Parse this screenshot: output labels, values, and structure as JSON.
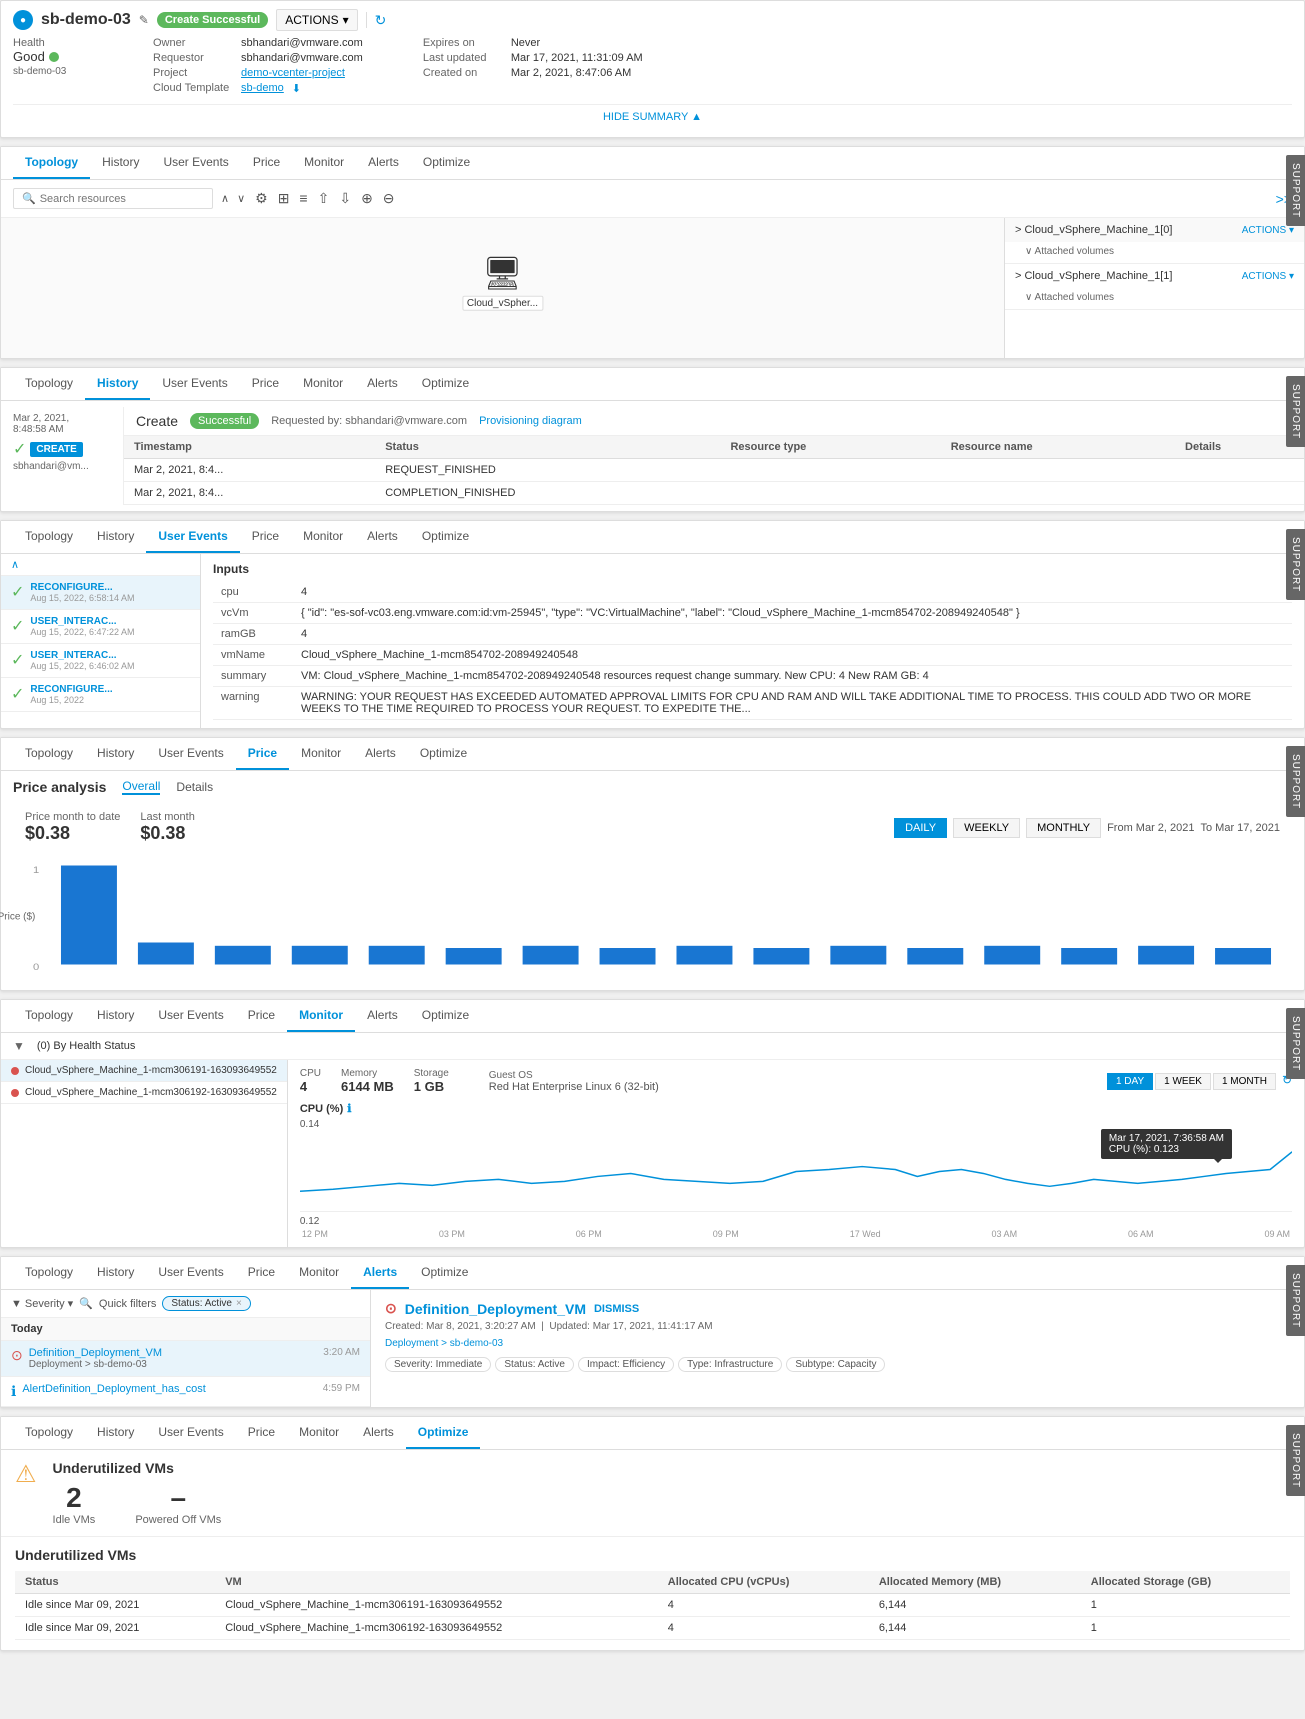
{
  "header": {
    "logo": "sb",
    "title": "sb-demo-03",
    "status": "Create Successful",
    "actions_label": "ACTIONS",
    "health_label": "Health",
    "health_value": "Good",
    "row1": {
      "owner_label": "Owner",
      "owner_val": "sbhandari@vmware.com",
      "expires_label": "Expires on",
      "expires_val": "Never"
    },
    "row2": {
      "requestor_label": "Requestor",
      "requestor_val": "sbhandari@vmware.com",
      "last_updated_label": "Last updated",
      "last_updated_val": "Mar 17, 2021, 11:31:09 AM"
    },
    "row3": {
      "project_label": "Project",
      "project_val": "demo-vcenter-project",
      "created_label": "Created on",
      "created_val": "Mar 2, 2021, 8:47:06 AM"
    },
    "row4": {
      "cloud_template_label": "Cloud Template",
      "cloud_template_val": "sb-demo"
    },
    "hide_summary": "HIDE SUMMARY ▲"
  },
  "tabs": {
    "topology": "Topology",
    "history": "History",
    "user_events": "User Events",
    "price": "Price",
    "monitor": "Monitor",
    "alerts": "Alerts",
    "optimize": "Optimize"
  },
  "topology_panel": {
    "search_placeholder": "Search resources",
    "vm_label": "Cloud_vSpher...",
    "resource1_name": "> Cloud_vSphere_Machine_1[0]",
    "resource1_actions": "ACTIONS ▾",
    "attached1": "∨ Attached volumes",
    "resource2_name": "> Cloud_vSphere_Machine_1[1]",
    "resource2_actions": "ACTIONS ▾",
    "attached2": "∨ Attached volumes"
  },
  "history_panel": {
    "event_date": "Mar 2, 2021,",
    "event_time": "8:48:58 AM",
    "event_user": "sbhandari@vm...",
    "badge": "CREATE",
    "create_label": "Create",
    "success_badge": "Successful",
    "requested_by": "Requested by: sbhandari@vmware.com",
    "prov_link": "Provisioning diagram",
    "table": {
      "cols": [
        "Timestamp",
        "Status",
        "Resource type",
        "Resource name",
        "Details"
      ],
      "rows": [
        [
          "Mar 2, 2021, 8:4...",
          "REQUEST_FINISHED",
          "",
          "",
          ""
        ],
        [
          "Mar 2, 2021, 8:4...",
          "COMPLETION_FINISHED",
          "",
          "",
          ""
        ]
      ]
    }
  },
  "user_events_panel": {
    "events": [
      {
        "date": "Aug 15, 2022, 6:58:14 AM",
        "name": "RECONFIGURE...",
        "selected": true
      },
      {
        "date": "Aug 15, 2022, 6:47:22 AM",
        "name": "USER_INTERAC..."
      },
      {
        "date": "Aug 15, 2022, 6:46:02 AM",
        "name": "USER_INTERAC..."
      },
      {
        "date": "Aug 15, 2022",
        "name": "RECONFIGURE..."
      }
    ],
    "inputs_title": "Inputs",
    "inputs": [
      {
        "key": "cpu",
        "value": "4"
      },
      {
        "key": "vcVm",
        "value": "{ \"id\": \"es-sof-vc03.eng.vmware.com:id:vm-25945\", \"type\": \"VC:VirtualMachine\", \"label\": \"Cloud_vSphere_Machine_1-mcm854702-208949240548\" }"
      },
      {
        "key": "ramGB",
        "value": "4"
      },
      {
        "key": "vmName",
        "value": "Cloud_vSphere_Machine_1-mcm854702-208949240548"
      },
      {
        "key": "summary",
        "value": "VM: Cloud_vSphere_Machine_1-mcm854702-208949240548 resources request change summary. New CPU: 4 New RAM GB: 4"
      },
      {
        "key": "warning",
        "value": "WARNING: YOUR REQUEST HAS EXCEEDED AUTOMATED APPROVAL LIMITS FOR CPU AND RAM AND WILL TAKE ADDITIONAL TIME TO PROCESS. THIS COULD ADD TWO OR MORE WEEKS TO THE TIME REQUIRED TO PROCESS YOUR REQUEST. TO EXPEDITE THE..."
      }
    ]
  },
  "price_panel": {
    "price_analysis": "Price analysis",
    "tab_overall": "Overall",
    "tab_details": "Details",
    "month_to_date_label": "Price month to date",
    "month_to_date_val": "$0.38",
    "last_month_label": "Last month",
    "last_month_val": "$0.38",
    "daily": "DAILY",
    "weekly": "WEEKLY",
    "monthly": "MONTHLY",
    "from": "From Mar 2, 2021",
    "to": "To Mar 17, 2021",
    "y_axis_label": "Price ($)",
    "chart_values": [
      0.9,
      0.15,
      0.15,
      0.15,
      0.15,
      0.12,
      0.15,
      0.12,
      0.15,
      0.12,
      0.15,
      0.12,
      0.15,
      0.12,
      0.15,
      0.12
    ]
  },
  "monitor_panel": {
    "filter_label": "(0) By Health Status",
    "vms": [
      {
        "name": "Cloud_vSphere_Machine_1-mcm306191-163093649552",
        "selected": true
      },
      {
        "name": "Cloud_vSphere_Machine_1-mcm306192-163093649552"
      }
    ],
    "cpu_label": "CPU",
    "cpu_val": "4",
    "memory_label": "Memory",
    "memory_val": "6144 MB",
    "storage_label": "Storage",
    "storage_val": "1 GB",
    "guest_os_label": "Guest OS",
    "guest_os_val": "Red Hat Enterprise Linux 6 (32-bit)",
    "day_btn": "1 DAY",
    "week_btn": "1 WEEK",
    "month_btn": "1 MONTH",
    "cpu_chart_title": "CPU (%)",
    "tooltip_date": "Mar 17, 2021, 7:36:58 AM",
    "tooltip_val": "CPU (%): 0.123",
    "chart_min": "0.12",
    "chart_max": "0.14",
    "x_labels": [
      "12 PM",
      "03 PM",
      "06 PM",
      "09 PM",
      "17 Wed",
      "03 AM",
      "06 AM",
      "09 AM"
    ]
  },
  "alerts_panel": {
    "severity_filter": "Severity ▾",
    "quick_filters": "Quick filters",
    "status_tag": "Status: Active",
    "today_header": "Today",
    "alerts_list": [
      {
        "icon": "warning",
        "name": "Definition_Deployment_VM",
        "sub": "Deployment > sb-demo-03",
        "time": "3:20 AM",
        "selected": true
      },
      {
        "icon": "info",
        "name": "AlertDefinition_Deployment_has_cost",
        "sub": "",
        "time": "4:59 PM"
      }
    ],
    "detail": {
      "title": "Definition_Deployment_VM",
      "dismiss": "DISMISS",
      "created": "Created: Mar 8, 2021, 3:20:27 AM",
      "updated": "Updated: Mar 17, 2021, 11:41:17 AM",
      "breadcrumb": "Deployment > sb-demo-03",
      "tags": [
        "Severity: Immediate",
        "Status: Active",
        "Impact: Efficiency",
        "Type: Infrastructure",
        "Subtype: Capacity"
      ]
    }
  },
  "optimize_panel": {
    "warning_icon": "⚠",
    "title": "Underutilized VMs",
    "idle_num": "2",
    "idle_label": "Idle VMs",
    "powered_off_dash": "–",
    "powered_off_label": "Powered Off VMs",
    "underutil_title": "Underutilized VMs",
    "table_cols": [
      "Status",
      "VM",
      "Allocated CPU (vCPUs)",
      "Allocated Memory (MB)",
      "Allocated Storage (GB)"
    ],
    "table_rows": [
      [
        "Idle since Mar 09, 2021",
        "Cloud_vSphere_Machine_1-mcm306191-163093649552",
        "4",
        "6,144",
        "1"
      ],
      [
        "Idle since Mar 09, 2021",
        "Cloud_vSphere_Machine_1-mcm306192-163093649552",
        "4",
        "6,144",
        "1"
      ]
    ]
  },
  "support_labels": {
    "support": "SUPPORT"
  }
}
